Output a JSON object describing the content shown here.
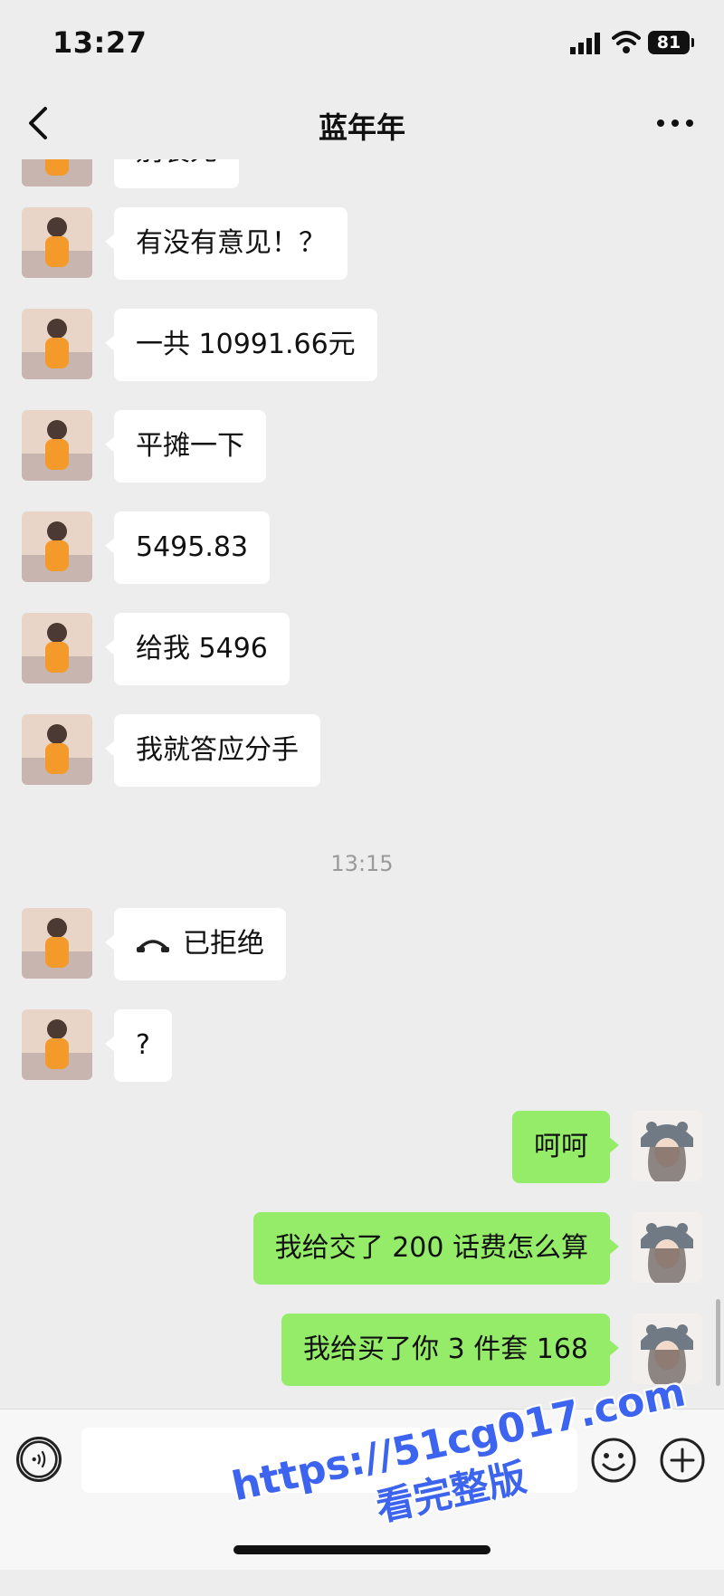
{
  "status_bar": {
    "time": "13:27",
    "battery": "81",
    "icons": [
      "signal-icon",
      "wifi-icon",
      "battery-icon"
    ]
  },
  "nav": {
    "title": "蓝年年",
    "back_icon": "back-chevron-icon",
    "more_icon": "more-icon"
  },
  "messages": [
    {
      "side": "left",
      "text": "别装死"
    },
    {
      "side": "left",
      "text": "有没有意见！？"
    },
    {
      "side": "left",
      "text": "一共 10991.66元"
    },
    {
      "side": "left",
      "text": "平摊一下"
    },
    {
      "side": "left",
      "text": "5495.83"
    },
    {
      "side": "left",
      "text": "给我 5496"
    },
    {
      "side": "left",
      "text": "我就答应分手"
    },
    {
      "side": "time",
      "text": "13:15"
    },
    {
      "side": "left",
      "text": "已拒绝",
      "icon": "call-declined-icon"
    },
    {
      "side": "left",
      "text": "?"
    },
    {
      "side": "right",
      "text": "呵呵"
    },
    {
      "side": "right",
      "text": "我给交了 200 话费怎么算"
    },
    {
      "side": "right",
      "text": "我给买了你 3 件套 168"
    }
  ],
  "input_bar": {
    "placeholder": "",
    "icons": [
      "voice-icon",
      "emoji-icon",
      "plus-icon"
    ]
  },
  "watermark": {
    "url": "https://51cg017.com",
    "text": "看完整版"
  },
  "colors": {
    "background": "#ededed",
    "bubble_received": "#ffffff",
    "bubble_sent": "#95ec69",
    "watermark": "#3d64ee"
  }
}
